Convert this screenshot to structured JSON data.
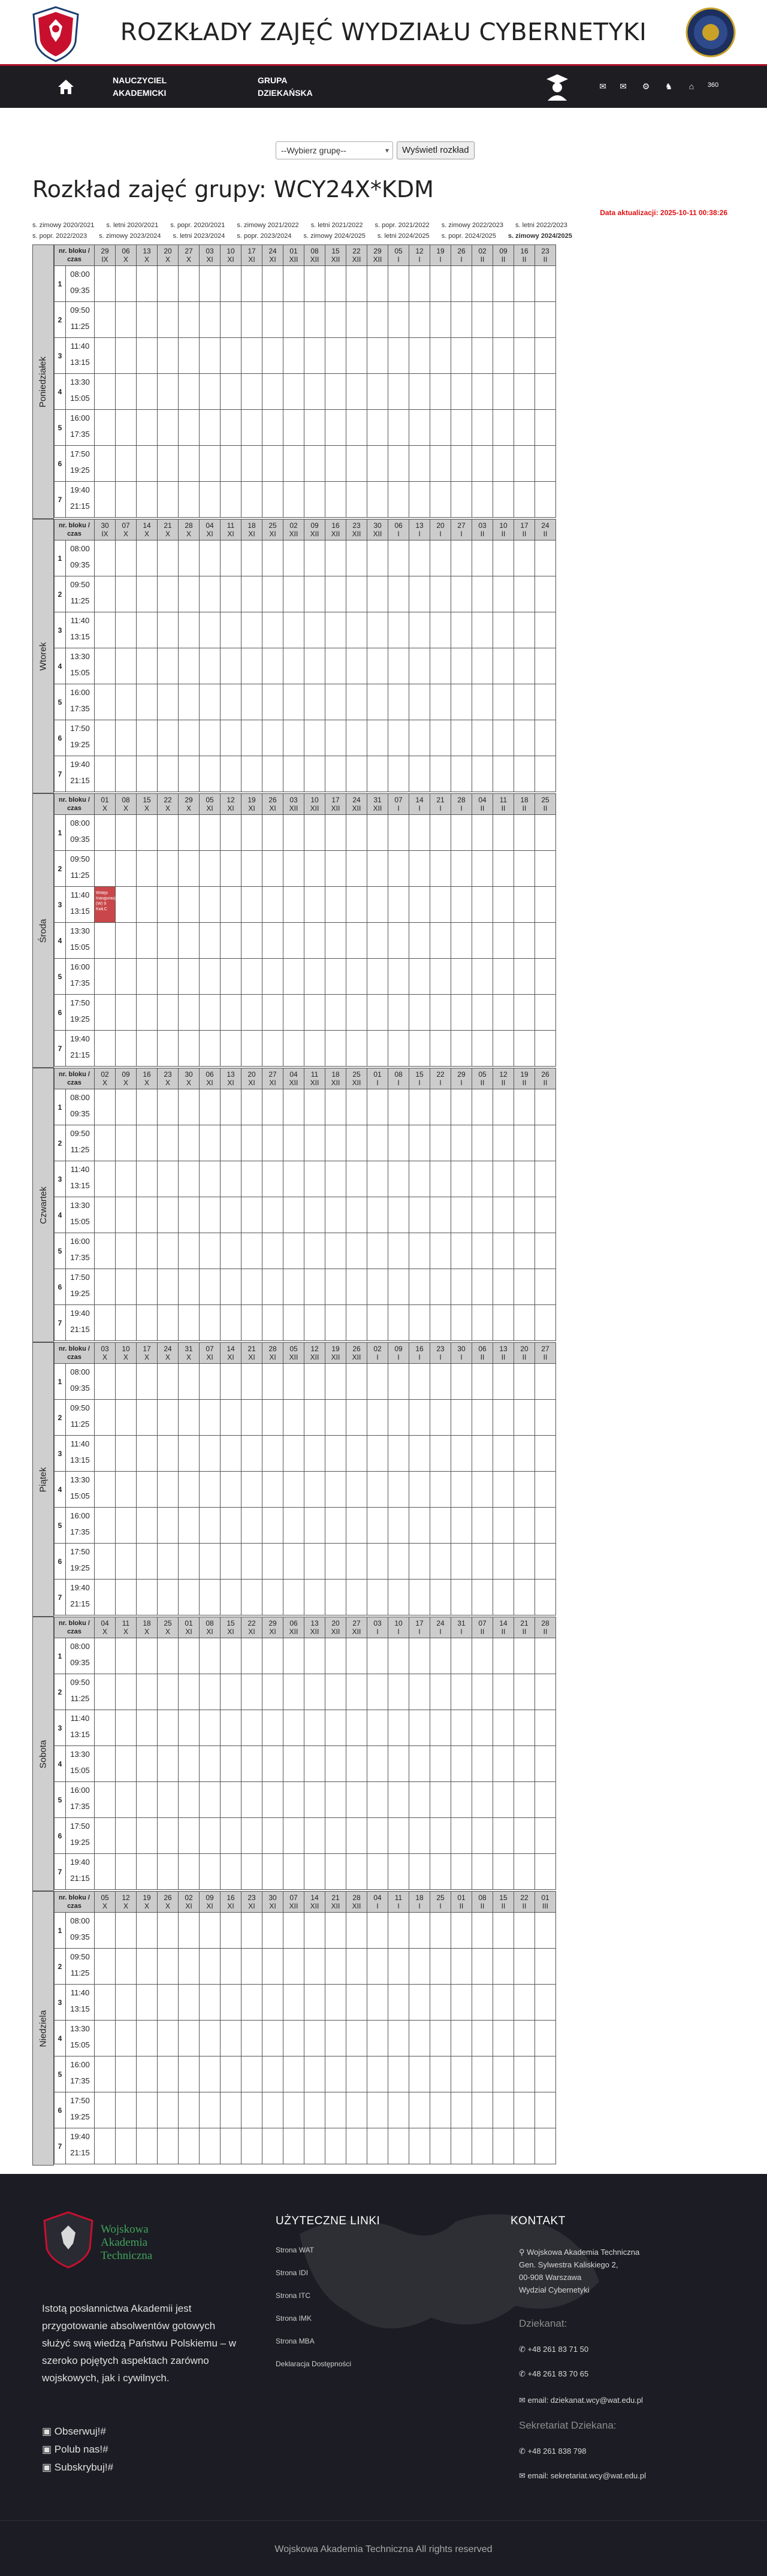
{
  "header": {
    "title": "ROZKŁADY ZAJĘĆ WYDZIAŁU CYBERNETYKI",
    "logo_text": "WAT"
  },
  "nav": {
    "items": [
      {
        "line1": "NAUCZYCIEL",
        "line2": "AKADEMICKI"
      },
      {
        "line1": "GRUPA",
        "line2": "DZIEKAŃSKA"
      }
    ],
    "social_icons": [
      "mail-icon",
      "mail-icon",
      "ministry-icon",
      "eagle-icon",
      "cap-icon",
      "360-icon"
    ]
  },
  "selector": {
    "group_placeholder": "--Wybierz grupę--",
    "show_button": "Wyświetl rozkład"
  },
  "page_title": "Rozkład zajęć grupy: WCY24X*KDM",
  "updated": "Data aktualizacji: 2025-10-11 00:38:26",
  "semesters": {
    "row1": [
      "s. zimowy 2020/2021",
      "s. letni 2020/2021",
      "s. popr. 2020/2021",
      "s. zimowy 2021/2022",
      "s. letni 2021/2022",
      "s. popr. 2021/2022",
      "s. zimowy 2022/2023",
      "s. letni 2022/2023"
    ],
    "row2": [
      "s. popr. 2022/2023",
      "s. zimowy 2023/2024",
      "s. letni 2023/2024",
      "s. popr. 2023/2024",
      "s. zimowy 2024/2025",
      "s. letni 2024/2025",
      "s. popr. 2024/2025",
      "s. zimowy 2024/2025"
    ]
  },
  "grid": {
    "corner_label": "nr. bloku / czas",
    "blocks": [
      {
        "nr": "1",
        "start": "08:00",
        "end": "09:35"
      },
      {
        "nr": "2",
        "start": "09:50",
        "end": "11:25"
      },
      {
        "nr": "3",
        "start": "11:40",
        "end": "13:15"
      },
      {
        "nr": "4",
        "start": "13:30",
        "end": "15:05"
      },
      {
        "nr": "5",
        "start": "16:00",
        "end": "17:35"
      },
      {
        "nr": "6",
        "start": "17:50",
        "mid": "",
        "end": "19:25"
      },
      {
        "nr": "7",
        "start": "19:40",
        "end": "21:15"
      }
    ],
    "days": [
      {
        "name": "Poniedziałek",
        "dates": [
          [
            "29",
            "IX"
          ],
          [
            "06",
            "X"
          ],
          [
            "13",
            "X"
          ],
          [
            "20",
            "X"
          ],
          [
            "27",
            "X"
          ],
          [
            "03",
            "XI"
          ],
          [
            "10",
            "XI"
          ],
          [
            "17",
            "XI"
          ],
          [
            "24",
            "XI"
          ],
          [
            "01",
            "XII"
          ],
          [
            "08",
            "XII"
          ],
          [
            "15",
            "XII"
          ],
          [
            "22",
            "XII"
          ],
          [
            "29",
            "XII"
          ],
          [
            "05",
            "I"
          ],
          [
            "12",
            "I"
          ],
          [
            "19",
            "I"
          ],
          [
            "26",
            "I"
          ],
          [
            "02",
            "II"
          ],
          [
            "09",
            "II"
          ],
          [
            "16",
            "II"
          ],
          [
            "23",
            "II"
          ]
        ]
      },
      {
        "name": "Wtorek",
        "dates": [
          [
            "30",
            "IX"
          ],
          [
            "07",
            "X"
          ],
          [
            "14",
            "X"
          ],
          [
            "21",
            "X"
          ],
          [
            "28",
            "X"
          ],
          [
            "04",
            "XI"
          ],
          [
            "11",
            "XI"
          ],
          [
            "18",
            "XI"
          ],
          [
            "25",
            "XI"
          ],
          [
            "02",
            "XII"
          ],
          [
            "09",
            "XII"
          ],
          [
            "16",
            "XII"
          ],
          [
            "23",
            "XII"
          ],
          [
            "30",
            "XII"
          ],
          [
            "06",
            "I"
          ],
          [
            "13",
            "I"
          ],
          [
            "20",
            "I"
          ],
          [
            "27",
            "I"
          ],
          [
            "03",
            "II"
          ],
          [
            "10",
            "II"
          ],
          [
            "17",
            "II"
          ],
          [
            "24",
            "II"
          ]
        ]
      },
      {
        "name": "Środa",
        "dates": [
          [
            "01",
            "X"
          ],
          [
            "08",
            "X"
          ],
          [
            "15",
            "X"
          ],
          [
            "22",
            "X"
          ],
          [
            "29",
            "X"
          ],
          [
            "05",
            "XI"
          ],
          [
            "12",
            "XI"
          ],
          [
            "19",
            "XI"
          ],
          [
            "26",
            "XI"
          ],
          [
            "03",
            "XII"
          ],
          [
            "10",
            "XII"
          ],
          [
            "17",
            "XII"
          ],
          [
            "24",
            "XII"
          ],
          [
            "31",
            "XII"
          ],
          [
            "07",
            "I"
          ],
          [
            "14",
            "I"
          ],
          [
            "21",
            "I"
          ],
          [
            "28",
            "I"
          ],
          [
            "04",
            "II"
          ],
          [
            "11",
            "II"
          ],
          [
            "18",
            "II"
          ],
          [
            "25",
            "II"
          ]
        ]
      },
      {
        "name": "Czwartek",
        "dates": [
          [
            "02",
            "X"
          ],
          [
            "09",
            "X"
          ],
          [
            "16",
            "X"
          ],
          [
            "23",
            "X"
          ],
          [
            "30",
            "X"
          ],
          [
            "06",
            "XI"
          ],
          [
            "13",
            "XI"
          ],
          [
            "20",
            "XI"
          ],
          [
            "27",
            "XI"
          ],
          [
            "04",
            "XII"
          ],
          [
            "11",
            "XII"
          ],
          [
            "18",
            "XII"
          ],
          [
            "25",
            "XII"
          ],
          [
            "01",
            "I"
          ],
          [
            "08",
            "I"
          ],
          [
            "15",
            "I"
          ],
          [
            "22",
            "I"
          ],
          [
            "29",
            "I"
          ],
          [
            "05",
            "II"
          ],
          [
            "12",
            "II"
          ],
          [
            "19",
            "II"
          ],
          [
            "26",
            "II"
          ]
        ]
      },
      {
        "name": "Piątek",
        "dates": [
          [
            "03",
            "X"
          ],
          [
            "10",
            "X"
          ],
          [
            "17",
            "X"
          ],
          [
            "24",
            "X"
          ],
          [
            "31",
            "X"
          ],
          [
            "07",
            "XI"
          ],
          [
            "14",
            "XI"
          ],
          [
            "21",
            "XI"
          ],
          [
            "28",
            "XI"
          ],
          [
            "05",
            "XII"
          ],
          [
            "12",
            "XII"
          ],
          [
            "19",
            "XII"
          ],
          [
            "26",
            "XII"
          ],
          [
            "02",
            "I"
          ],
          [
            "09",
            "I"
          ],
          [
            "16",
            "I"
          ],
          [
            "23",
            "I"
          ],
          [
            "30",
            "I"
          ],
          [
            "06",
            "II"
          ],
          [
            "13",
            "II"
          ],
          [
            "20",
            "II"
          ],
          [
            "27",
            "II"
          ]
        ]
      },
      {
        "name": "Sobota",
        "dates": [
          [
            "04",
            "X"
          ],
          [
            "11",
            "X"
          ],
          [
            "18",
            "X"
          ],
          [
            "25",
            "X"
          ],
          [
            "01",
            "XI"
          ],
          [
            "08",
            "XI"
          ],
          [
            "15",
            "XI"
          ],
          [
            "22",
            "XI"
          ],
          [
            "29",
            "XI"
          ],
          [
            "06",
            "XII"
          ],
          [
            "13",
            "XII"
          ],
          [
            "20",
            "XII"
          ],
          [
            "27",
            "XII"
          ],
          [
            "03",
            "I"
          ],
          [
            "10",
            "I"
          ],
          [
            "17",
            "I"
          ],
          [
            "24",
            "I"
          ],
          [
            "31",
            "I"
          ],
          [
            "07",
            "II"
          ],
          [
            "14",
            "II"
          ],
          [
            "21",
            "II"
          ],
          [
            "28",
            "II"
          ]
        ]
      },
      {
        "name": "Niedziela",
        "dates": [
          [
            "05",
            "X"
          ],
          [
            "12",
            "X"
          ],
          [
            "19",
            "X"
          ],
          [
            "26",
            "X"
          ],
          [
            "02",
            "XI"
          ],
          [
            "09",
            "XI"
          ],
          [
            "16",
            "XI"
          ],
          [
            "23",
            "XI"
          ],
          [
            "30",
            "XI"
          ],
          [
            "07",
            "XII"
          ],
          [
            "14",
            "XII"
          ],
          [
            "21",
            "XII"
          ],
          [
            "28",
            "XII"
          ],
          [
            "04",
            "I"
          ],
          [
            "11",
            "I"
          ],
          [
            "18",
            "I"
          ],
          [
            "25",
            "I"
          ],
          [
            "01",
            "II"
          ],
          [
            "08",
            "II"
          ],
          [
            "15",
            "II"
          ],
          [
            "22",
            "II"
          ],
          [
            "01",
            "III"
          ]
        ]
      }
    ],
    "events": [
      {
        "day": 2,
        "block": 2,
        "col": 0,
        "text": "Wstęp Inauguracja (W) 9 KwŁC",
        "color": "#c9474a"
      }
    ]
  },
  "footer": {
    "brand": [
      "Wojskowa",
      "Akademia",
      "Techniczna"
    ],
    "about": "Istotą posłannictwa Akademii jest przygotowanie absolwentów gotowych służyć swą wiedzą Państwu Polskiemu – w szeroko pojętych aspektach zarówno wojskowych, jak i cywilnych.",
    "social": [
      "Obserwuj!",
      "Polub nas!",
      "Subskrybuj!"
    ],
    "links_title": "UŻYTECZNE LINKI",
    "links": [
      "Strona WAT",
      "Strona IDI",
      "Strona ITC",
      "Strona IMK",
      "Strona MBA",
      "Deklaracja Dostępności"
    ],
    "contact_title": "KONTAKT",
    "address": [
      "Wojskowa Akademia Techniczna",
      "Gen. Sylwestra Kaliskiego 2,",
      "00-908 Warszawa",
      "Wydział Cybernetyki"
    ],
    "dean_label": "Dziekanat:",
    "dean_phones": [
      "+48 261 83 71 50",
      "+48 261 83 70 65"
    ],
    "dean_email": "email: dziekanat.wcy@wat.edu.pl",
    "secretary_label": "Sekretariat Dziekana:",
    "secretary_phone": "+48 261 838 798",
    "secretary_email": "email: sekretariat.wcy@wat.edu.pl",
    "copyright": "Wojskowa Akademia Techniczna All rights reserved"
  }
}
